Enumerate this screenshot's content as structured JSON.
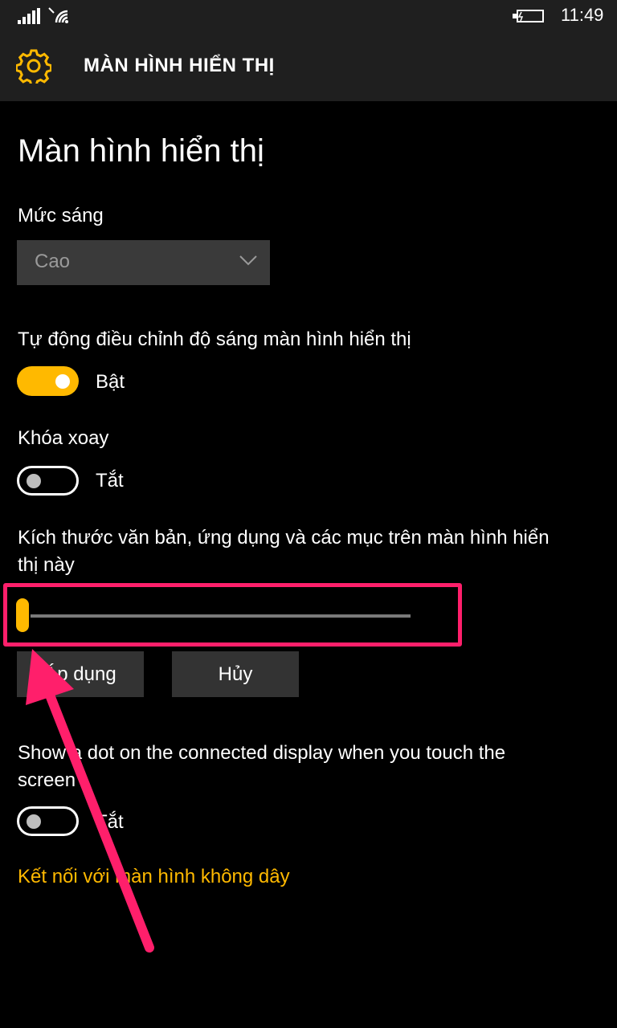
{
  "status_bar": {
    "time": "11:49",
    "signal_icon": "signal-bars-icon",
    "wifi_icon": "wifi-icon",
    "battery_icon": "battery-charging-icon"
  },
  "header": {
    "icon": "gear-icon",
    "title": "MÀN HÌNH HIỂN THỊ"
  },
  "page": {
    "title": "Màn hình hiển thị"
  },
  "brightness": {
    "label": "Mức sáng",
    "selected": "Cao"
  },
  "auto_brightness": {
    "label": "Tự động điều chỉnh độ sáng màn hình hiển thị",
    "state": "Bật",
    "on": true
  },
  "rotation_lock": {
    "label": "Khóa xoay",
    "state": "Tắt",
    "on": false
  },
  "scale": {
    "label_line1": "Kích thước văn bản, ứng dụng và các mục trên màn hình hiển",
    "label_line2": "thị này",
    "value_fraction": 0.0
  },
  "buttons": {
    "apply": "Áp dụng",
    "cancel": "Hủy"
  },
  "touch_dot": {
    "label_line1": "Show a dot on the connected display when you touch the",
    "label_line2": "screen",
    "state": "Tắt",
    "on": false
  },
  "wireless_link": "Kết nối với màn hình không dây",
  "colors": {
    "accent": "#ffb900",
    "annotation": "#ff1f6b",
    "background": "#000000",
    "header_bg": "#1f1f1f"
  }
}
